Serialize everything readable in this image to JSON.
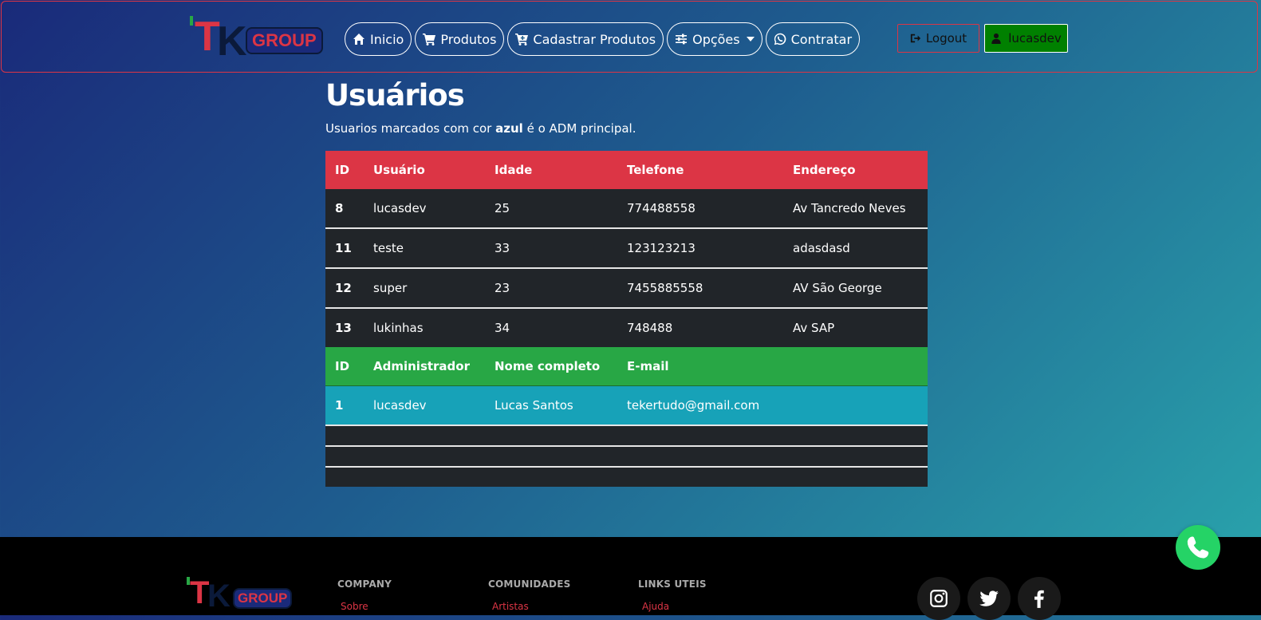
{
  "brand": {
    "logo_text_1": "T",
    "logo_text_2": "K",
    "logo_group": "GROUP",
    "accent_red": "#dc3545",
    "accent_green": "#28a745"
  },
  "nav": {
    "items": [
      {
        "label": "Inicio",
        "icon": "home-icon"
      },
      {
        "label": "Produtos",
        "icon": "cart-icon"
      },
      {
        "label": "Cadastrar Produtos",
        "icon": "cart-plus-icon"
      },
      {
        "label": "Opções",
        "icon": "sliders-icon",
        "dropdown": true
      },
      {
        "label": "Contratar",
        "icon": "whatsapp-icon"
      }
    ],
    "logout_label": "Logout",
    "user_label": "lucasdev"
  },
  "page": {
    "title": "Usuários",
    "subtitle_pre": "Usuarios marcados com cor ",
    "subtitle_bold": "azul",
    "subtitle_post": " é o ADM principal."
  },
  "users_table": {
    "headers": [
      "ID",
      "Usuário",
      "Idade",
      "Telefone",
      "Endereço"
    ],
    "rows": [
      [
        "8",
        "lucasdev",
        "25",
        "774488558",
        "Av Tancredo Neves"
      ],
      [
        "11",
        "teste",
        "33",
        "123123213",
        "adasdasd"
      ],
      [
        "12",
        "super",
        "23",
        "7455885558",
        "AV São George"
      ],
      [
        "13",
        "lukinhas",
        "34",
        "748488",
        "Av SAP"
      ]
    ]
  },
  "admins_table": {
    "headers": [
      "ID",
      "Administrador",
      "Nome completo",
      "E-mail"
    ],
    "rows": [
      [
        "1",
        "lucasdev",
        "Lucas Santos",
        "tekertudo@gmail.com"
      ]
    ],
    "highlight_color": "#17a2b8"
  },
  "footer": {
    "col1_heading": "COMPANY",
    "col1_link": "Sobre",
    "col2_heading": "COMUNIDADES",
    "col2_link": "Artistas",
    "col3_heading": "LINKS UTEIS",
    "col3_link": "Ajuda",
    "social": [
      "instagram-icon",
      "twitter-icon",
      "facebook-icon"
    ]
  }
}
